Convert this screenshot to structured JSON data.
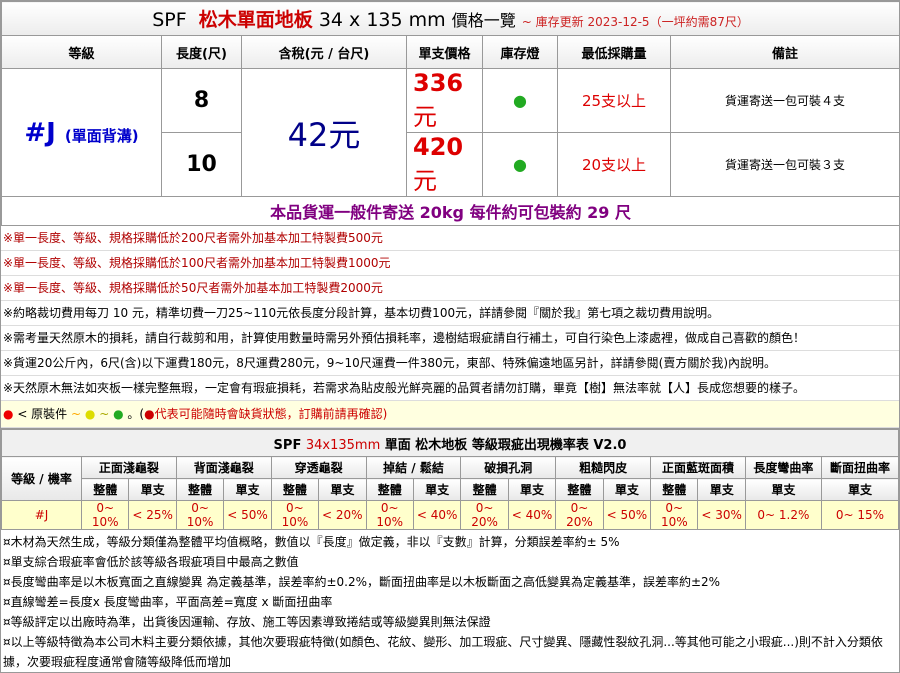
{
  "header": {
    "spf": "SPF",
    "title": "松木單面地板",
    "size": "34 x 135 mm",
    "subtitle": "價格一覽",
    "update": "~ 庫存更新 2023-12-5（一坪約需87尺）"
  },
  "columns": [
    "等級",
    "長度(尺)",
    "含稅(元 / 台尺)",
    "單支價格",
    "庫存燈",
    "最低採購量",
    "備註"
  ],
  "product": {
    "grade": "#J",
    "grade_note": "(單面背溝)",
    "price": "42元",
    "rows": [
      {
        "length": "8",
        "unit_num": "336",
        "unit_yuan": "元",
        "stock": "●",
        "min": "25支以上",
        "remark": "貨運寄送一包可裝４支"
      },
      {
        "length": "10",
        "unit_num": "420",
        "unit_yuan": "元",
        "stock": "●",
        "min": "20支以上",
        "remark": "貨運寄送一包可裝３支"
      }
    ]
  },
  "shipping": "本品貨運一般件寄送 20kg 每件約可包裝約 29 尺",
  "notes": [
    "※單一長度、等級、規格採購低於200尺者需外加基本加工特製費500元",
    "※單一長度、等級、規格採購低於100尺者需外加基本加工特製費1000元",
    "※單一長度、等級、規格採購低於50尺者需外加基本加工特製費2000元",
    "※約略裁切費用每刀 10 元，精準切費一刀25~110元依長度分段計算，基本切費100元，詳請參閱『關於我』第七項之裁切費用說明。",
    "※需考量天然原木的損耗，請自行裁剪和用，計算使用數量時需另外預估損耗率，邊樹結瑕疵請自行補土，可自行染色上漆處裡，做成自己喜歡的顏色！",
    "※貨運20公斤內，6尺(含)以下運費180元，8尺運費280元，9~10尺運費一件380元，東部、特殊偏遠地區另計，詳請參閱(賣方關於我)內說明。",
    "※天然原木無法如夾板一樣完整無瑕，一定會有瑕疵損耗，若需求為貼皮般光鮮亮麗的品質者請勿訂購，畢竟【樹】無法率就【人】長成您想要的樣子。"
  ],
  "legend": {
    "label": "< 原裝件",
    "tilde1": "~",
    "tilde2": "~",
    "dot_sep": "。(",
    "warn": "●代表可能隨時會缺貨狀態，訂購前請再確認)"
  },
  "table2": {
    "spf": "SPF",
    "size": "34x135mm",
    "title": "單面 松木地板 等級瑕疵出現機率表 V2.0",
    "rowhead": "等級 / 機率",
    "groups": [
      "正面淺龜裂",
      "背面淺龜裂",
      "穿透龜裂",
      "掉結 / 鬆結",
      "破損孔洞",
      "粗糙閃皮",
      "正面藍斑面積",
      "長度彎曲率",
      "斷面扭曲率"
    ],
    "whole": "整體",
    "single": "單支",
    "grade": "#J",
    "values": [
      "0~ 10%",
      "< 25%",
      "0~ 10%",
      "< 50%",
      "0~ 10%",
      "< 20%",
      "0~ 10%",
      "< 40%",
      "0~ 20%",
      "< 40%",
      "0~ 20%",
      "< 50%",
      "0~ 10%",
      "< 30%",
      "0~ 1.2%",
      "0~ 15%"
    ]
  },
  "footnotes": [
    "¤木材為天然生成，等級分類僅為整體平均值概略，數值以『長度』做定義，非以『支數』計算，分類誤差率約± 5%",
    "¤單支綜合瑕疵率會低於該等級各瑕疵項目中最高之數值",
    "¤長度彎曲率是以木板寬面之直線變異 為定義基準，誤差率約±0.2%，斷面扭曲率是以木板斷面之高低變異為定義基準，誤差率約±2%",
    "¤直線彎差=長度x 長度彎曲率，平面高差=寬度 x 斷面扭曲率",
    "¤等級評定以出廠時為準，出貨後因運輸、存放、施工等因素導致捲結或等級變異則無法保證",
    "¤以上等級特徵為本公司木料主要分類依據，其他次要瑕疵特徵(如顏色、花紋、變形、加工瑕疵、尺寸變異、隱藏性裂紋孔洞...等其他可能之小瑕疵...)則不計入分類依據，次要瑕疵程度通常會隨等級降低而增加"
  ],
  "colors": {
    "red": "#cc0000",
    "blue": "#0000cc",
    "green": "#22aa22",
    "purple": "#800080",
    "yellow_bg": "#ffffcc"
  }
}
